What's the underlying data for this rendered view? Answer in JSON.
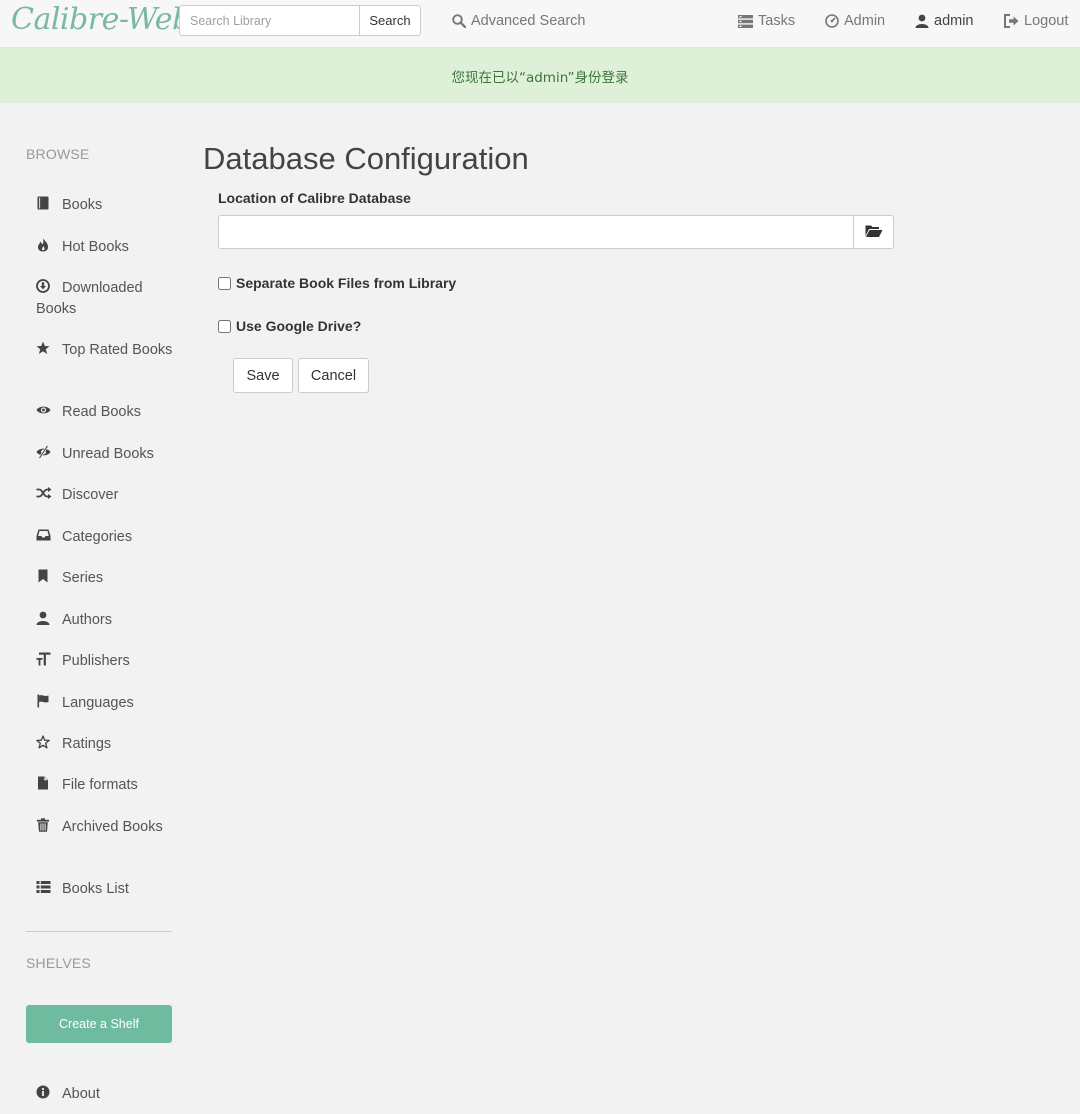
{
  "brand": "Calibre-Web",
  "search": {
    "placeholder": "Search Library",
    "button_label": "Search"
  },
  "nav": {
    "advanced_search": "Advanced Search",
    "tasks": "Tasks",
    "admin": "Admin",
    "user": "admin",
    "logout": "Logout"
  },
  "flash": "您现在已以“admin”身份登录",
  "sidebar": {
    "browse_header": "BROWSE",
    "items": [
      {
        "label": "Books",
        "icon": "book-icon"
      },
      {
        "label": "Hot Books",
        "icon": "fire-icon"
      },
      {
        "label": "Downloaded Books",
        "icon": "download-circle-icon"
      },
      {
        "label": "Top Rated Books",
        "icon": "star-icon"
      },
      {
        "label": "Read Books",
        "icon": "eye-icon"
      },
      {
        "label": "Unread Books",
        "icon": "eye-slash-icon"
      },
      {
        "label": "Discover",
        "icon": "random-icon"
      },
      {
        "label": "Categories",
        "icon": "inbox-icon"
      },
      {
        "label": "Series",
        "icon": "bookmark-icon"
      },
      {
        "label": "Authors",
        "icon": "user-icon"
      },
      {
        "label": "Publishers",
        "icon": "text-size-icon"
      },
      {
        "label": "Languages",
        "icon": "flag-icon"
      },
      {
        "label": "Ratings",
        "icon": "star-empty-icon"
      },
      {
        "label": "File formats",
        "icon": "file-icon"
      },
      {
        "label": "Archived Books",
        "icon": "trash-icon"
      },
      {
        "label": "Books List",
        "icon": "list-icon"
      }
    ],
    "shelves_header": "SHELVES",
    "create_shelf": "Create a Shelf",
    "about": "About"
  },
  "main": {
    "title": "Database Configuration",
    "location_label": "Location of Calibre Database",
    "location_value": "",
    "separate_files_label": "Separate Book Files from Library",
    "separate_files_checked": false,
    "google_drive_label": "Use Google Drive?",
    "google_drive_checked": false,
    "save_label": "Save",
    "cancel_label": "Cancel"
  }
}
